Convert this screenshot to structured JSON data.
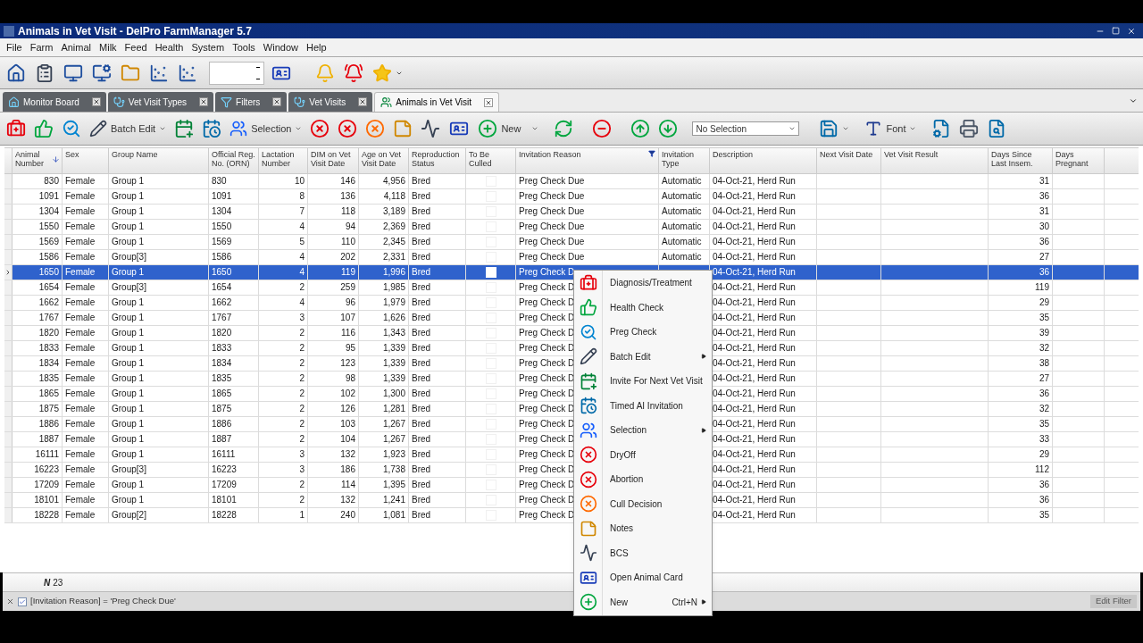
{
  "window": {
    "title": "Animals in Vet Visit - DelPro FarmManager 5.7"
  },
  "menu_bar": [
    "File",
    "Farm",
    "Animal",
    "Milk",
    "Feed",
    "Health",
    "System",
    "Tools",
    "Window",
    "Help"
  ],
  "tabs": [
    {
      "label": "Monitor Board",
      "selected": false
    },
    {
      "label": "Vet Visit Types",
      "selected": false
    },
    {
      "label": "Filters",
      "selected": false
    },
    {
      "label": "Vet Visits",
      "selected": false
    },
    {
      "label": "Animals in Vet Visit",
      "selected": true
    }
  ],
  "action_toolbar": {
    "buttons": [
      "Batch Edit",
      "Selection",
      "New",
      "Font"
    ],
    "selection_field": "No Selection"
  },
  "grid": {
    "columns": [
      {
        "label": "Animal Number",
        "sorted": true,
        "filtered": false
      },
      {
        "label": "Sex",
        "sorted": false,
        "filtered": false
      },
      {
        "label": "Group Name",
        "sorted": false,
        "filtered": false
      },
      {
        "label": "Official Reg. No. (ORN)",
        "sorted": false,
        "filtered": false
      },
      {
        "label": "Lactation Number",
        "sorted": false,
        "filtered": false
      },
      {
        "label": "DIM on Vet Visit Date",
        "sorted": false,
        "filtered": false
      },
      {
        "label": "Age on Vet Visit Date",
        "sorted": false,
        "filtered": false
      },
      {
        "label": "Reproduction Status",
        "sorted": false,
        "filtered": false
      },
      {
        "label": "To Be Culled",
        "sorted": false,
        "filtered": false
      },
      {
        "label": "Invitation Reason",
        "sorted": false,
        "filtered": true
      },
      {
        "label": "Invitation Type",
        "sorted": false,
        "filtered": false
      },
      {
        "label": "Description",
        "sorted": false,
        "filtered": false
      },
      {
        "label": "Next Visit Date",
        "sorted": false,
        "filtered": false
      },
      {
        "label": "Vet Visit Result",
        "sorted": false,
        "filtered": false
      },
      {
        "label": "Days Since Last Insem.",
        "sorted": false,
        "filtered": false
      },
      {
        "label": "Days Pregnant",
        "sorted": false,
        "filtered": false
      }
    ],
    "rows": [
      {
        "animal_number": "830",
        "sex": "Female",
        "group": "Group 1",
        "orn": "830",
        "lactation": "10",
        "dim": "146",
        "age": "4,956",
        "status": "Bred",
        "to_be_culled": false,
        "invitation_reason": "Preg Check Due",
        "invitation_type": "Automatic",
        "description": "04-Oct-21, Herd Run",
        "days_since_insem": "31",
        "selected": false
      },
      {
        "animal_number": "1091",
        "sex": "Female",
        "group": "Group 1",
        "orn": "1091",
        "lactation": "8",
        "dim": "136",
        "age": "4,118",
        "status": "Bred",
        "to_be_culled": false,
        "invitation_reason": "Preg Check Due",
        "invitation_type": "Automatic",
        "description": "04-Oct-21, Herd Run",
        "days_since_insem": "36",
        "selected": false
      },
      {
        "animal_number": "1304",
        "sex": "Female",
        "group": "Group 1",
        "orn": "1304",
        "lactation": "7",
        "dim": "118",
        "age": "3,189",
        "status": "Bred",
        "to_be_culled": false,
        "invitation_reason": "Preg Check Due",
        "invitation_type": "Automatic",
        "description": "04-Oct-21, Herd Run",
        "days_since_insem": "31",
        "selected": false
      },
      {
        "animal_number": "1550",
        "sex": "Female",
        "group": "Group 1",
        "orn": "1550",
        "lactation": "4",
        "dim": "94",
        "age": "2,369",
        "status": "Bred",
        "to_be_culled": false,
        "invitation_reason": "Preg Check Due",
        "invitation_type": "Automatic",
        "description": "04-Oct-21, Herd Run",
        "days_since_insem": "30",
        "selected": false
      },
      {
        "animal_number": "1569",
        "sex": "Female",
        "group": "Group 1",
        "orn": "1569",
        "lactation": "5",
        "dim": "110",
        "age": "2,345",
        "status": "Bred",
        "to_be_culled": false,
        "invitation_reason": "Preg Check Due",
        "invitation_type": "Automatic",
        "description": "04-Oct-21, Herd Run",
        "days_since_insem": "36",
        "selected": false
      },
      {
        "animal_number": "1586",
        "sex": "Female",
        "group": "Group[3]",
        "orn": "1586",
        "lactation": "4",
        "dim": "202",
        "age": "2,331",
        "status": "Bred",
        "to_be_culled": false,
        "invitation_reason": "Preg Check Due",
        "invitation_type": "Automatic",
        "description": "04-Oct-21, Herd Run",
        "days_since_insem": "27",
        "selected": false
      },
      {
        "animal_number": "1650",
        "sex": "Female",
        "group": "Group 1",
        "orn": "1650",
        "lactation": "4",
        "dim": "119",
        "age": "1,996",
        "status": "Bred",
        "to_be_culled": false,
        "invitation_reason": "Preg Check D",
        "description": "04-Oct-21, Herd Run",
        "days_since_insem": "36",
        "selected": true
      },
      {
        "animal_number": "1654",
        "sex": "Female",
        "group": "Group[3]",
        "orn": "1654",
        "lactation": "2",
        "dim": "259",
        "age": "1,985",
        "status": "Bred",
        "to_be_culled": false,
        "invitation_reason": "Preg Check D",
        "description": "04-Oct-21, Herd Run",
        "days_since_insem": "119",
        "selected": false
      },
      {
        "animal_number": "1662",
        "sex": "Female",
        "group": "Group 1",
        "orn": "1662",
        "lactation": "4",
        "dim": "96",
        "age": "1,979",
        "status": "Bred",
        "to_be_culled": false,
        "invitation_reason": "Preg Check D",
        "description": "04-Oct-21, Herd Run",
        "days_since_insem": "29",
        "selected": false
      },
      {
        "animal_number": "1767",
        "sex": "Female",
        "group": "Group 1",
        "orn": "1767",
        "lactation": "3",
        "dim": "107",
        "age": "1,626",
        "status": "Bred",
        "to_be_culled": false,
        "invitation_reason": "Preg Check D",
        "description": "04-Oct-21, Herd Run",
        "days_since_insem": "35",
        "selected": false
      },
      {
        "animal_number": "1820",
        "sex": "Female",
        "group": "Group 1",
        "orn": "1820",
        "lactation": "2",
        "dim": "116",
        "age": "1,343",
        "status": "Bred",
        "to_be_culled": false,
        "invitation_reason": "Preg Check D",
        "description": "04-Oct-21, Herd Run",
        "days_since_insem": "39",
        "selected": false
      },
      {
        "animal_number": "1833",
        "sex": "Female",
        "group": "Group 1",
        "orn": "1833",
        "lactation": "2",
        "dim": "95",
        "age": "1,339",
        "status": "Bred",
        "to_be_culled": false,
        "invitation_reason": "Preg Check D",
        "description": "04-Oct-21, Herd Run",
        "days_since_insem": "32",
        "selected": false
      },
      {
        "animal_number": "1834",
        "sex": "Female",
        "group": "Group 1",
        "orn": "1834",
        "lactation": "2",
        "dim": "123",
        "age": "1,339",
        "status": "Bred",
        "to_be_culled": false,
        "invitation_reason": "Preg Check D",
        "description": "04-Oct-21, Herd Run",
        "days_since_insem": "38",
        "selected": false
      },
      {
        "animal_number": "1835",
        "sex": "Female",
        "group": "Group 1",
        "orn": "1835",
        "lactation": "2",
        "dim": "98",
        "age": "1,339",
        "status": "Bred",
        "to_be_culled": false,
        "invitation_reason": "Preg Check D",
        "description": "04-Oct-21, Herd Run",
        "days_since_insem": "27",
        "selected": false
      },
      {
        "animal_number": "1865",
        "sex": "Female",
        "group": "Group 1",
        "orn": "1865",
        "lactation": "2",
        "dim": "102",
        "age": "1,300",
        "status": "Bred",
        "to_be_culled": false,
        "invitation_reason": "Preg Check D",
        "description": "04-Oct-21, Herd Run",
        "days_since_insem": "36",
        "selected": false
      },
      {
        "animal_number": "1875",
        "sex": "Female",
        "group": "Group 1",
        "orn": "1875",
        "lactation": "2",
        "dim": "126",
        "age": "1,281",
        "status": "Bred",
        "to_be_culled": false,
        "invitation_reason": "Preg Check D",
        "description": "04-Oct-21, Herd Run",
        "days_since_insem": "32",
        "selected": false
      },
      {
        "animal_number": "1886",
        "sex": "Female",
        "group": "Group 1",
        "orn": "1886",
        "lactation": "2",
        "dim": "103",
        "age": "1,267",
        "status": "Bred",
        "to_be_culled": false,
        "invitation_reason": "Preg Check D",
        "description": "04-Oct-21, Herd Run",
        "days_since_insem": "35",
        "selected": false
      },
      {
        "animal_number": "1887",
        "sex": "Female",
        "group": "Group 1",
        "orn": "1887",
        "lactation": "2",
        "dim": "104",
        "age": "1,267",
        "status": "Bred",
        "to_be_culled": false,
        "invitation_reason": "Preg Check D",
        "description": "04-Oct-21, Herd Run",
        "days_since_insem": "33",
        "selected": false
      },
      {
        "animal_number": "16111",
        "sex": "Female",
        "group": "Group 1",
        "orn": "16111",
        "lactation": "3",
        "dim": "132",
        "age": "1,923",
        "status": "Bred",
        "to_be_culled": false,
        "invitation_reason": "Preg Check D",
        "description": "04-Oct-21, Herd Run",
        "days_since_insem": "29",
        "selected": false
      },
      {
        "animal_number": "16223",
        "sex": "Female",
        "group": "Group[3]",
        "orn": "16223",
        "lactation": "3",
        "dim": "186",
        "age": "1,738",
        "status": "Bred",
        "to_be_culled": false,
        "invitation_reason": "Preg Check D",
        "description": "04-Oct-21, Herd Run",
        "days_since_insem": "112",
        "selected": false
      },
      {
        "animal_number": "17209",
        "sex": "Female",
        "group": "Group 1",
        "orn": "17209",
        "lactation": "2",
        "dim": "114",
        "age": "1,395",
        "status": "Bred",
        "to_be_culled": false,
        "invitation_reason": "Preg Check D",
        "description": "04-Oct-21, Herd Run",
        "days_since_insem": "36",
        "selected": false
      },
      {
        "animal_number": "18101",
        "sex": "Female",
        "group": "Group 1",
        "orn": "18101",
        "lactation": "2",
        "dim": "132",
        "age": "1,241",
        "status": "Bred",
        "to_be_culled": false,
        "invitation_reason": "Preg Check D",
        "description": "04-Oct-21, Herd Run",
        "days_since_insem": "36",
        "selected": false
      },
      {
        "animal_number": "18228",
        "sex": "Female",
        "group": "Group[2]",
        "orn": "18228",
        "lactation": "1",
        "dim": "240",
        "age": "1,081",
        "status": "Bred",
        "to_be_culled": false,
        "invitation_reason": "Preg Check D",
        "description": "04-Oct-21, Herd Run",
        "days_since_insem": "35",
        "selected": false
      }
    ]
  },
  "summary": {
    "symbol": "N",
    "count": "23"
  },
  "filter_bar": {
    "enabled": true,
    "expression": "[Invitation Reason] = 'Preg Check Due'",
    "edit_link": "Edit Filter"
  },
  "context_menu": [
    {
      "kind": "diagnosis",
      "label": "Diagnosis/Treatment",
      "submenu": false
    },
    {
      "kind": "health",
      "label": "Health Check",
      "submenu": false
    },
    {
      "kind": "preg",
      "label": "Preg Check",
      "submenu": false
    },
    {
      "kind": "batch",
      "label": "Batch Edit",
      "submenu": true
    },
    {
      "kind": "invite",
      "label": "Invite For Next Vet Visit",
      "submenu": false
    },
    {
      "kind": "timed",
      "label": "Timed AI Invitation",
      "submenu": false
    },
    {
      "kind": "selection",
      "label": "Selection",
      "submenu": true
    },
    {
      "kind": "dryoff",
      "label": "DryOff",
      "submenu": false
    },
    {
      "kind": "abortion",
      "label": "Abortion",
      "submenu": false
    },
    {
      "kind": "cull",
      "label": "Cull Decision",
      "submenu": false
    },
    {
      "kind": "notes",
      "label": "Notes",
      "submenu": false
    },
    {
      "kind": "bcs",
      "label": "BCS",
      "submenu": false
    },
    {
      "kind": "card",
      "label": "Open Animal Card",
      "submenu": false
    },
    {
      "kind": "new",
      "label": "New",
      "shortcut": "Ctrl+N",
      "submenu": true
    }
  ]
}
